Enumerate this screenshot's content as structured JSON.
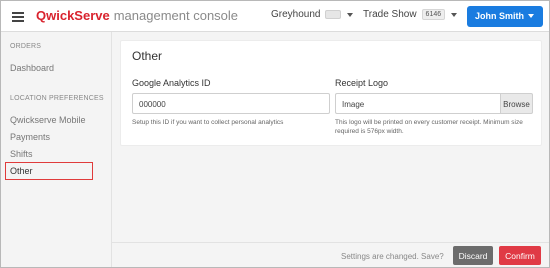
{
  "app": {
    "brand_q": "Qwick",
    "brand_s": "Serve",
    "subtitle": "management console"
  },
  "topbar": {
    "location_label": "Greyhound",
    "event_label": "Trade Show",
    "event_badge": "6146",
    "user_label": "John Smith"
  },
  "sidebar": {
    "sections": [
      {
        "title": "ORDERS",
        "items": [
          {
            "label": "Dashboard"
          }
        ]
      },
      {
        "title": "LOCATION PREFERENCES",
        "items": [
          {
            "label": "Qwickserve Mobile"
          },
          {
            "label": "Payments"
          },
          {
            "label": "Shifts"
          },
          {
            "label": "Other",
            "active": true
          }
        ]
      }
    ]
  },
  "main": {
    "card_title": "Other",
    "ga": {
      "label": "Google Analytics ID",
      "value": "000000",
      "help": "Setup this ID if you want to collect personal analytics"
    },
    "logo": {
      "label": "Receipt Logo",
      "value": "Image",
      "browse_label": "Browse",
      "help": "This logo will be printed on every customer receipt. Minimum size required is 576px width."
    }
  },
  "footer": {
    "message": "Settings are changed. Save?",
    "discard_label": "Discard",
    "confirm_label": "Confirm"
  },
  "colors": {
    "accent_blue": "#1a7ce0",
    "brand_red": "#d9232e",
    "confirm_red": "#e03a45",
    "discard_gray": "#6c6c6c"
  }
}
